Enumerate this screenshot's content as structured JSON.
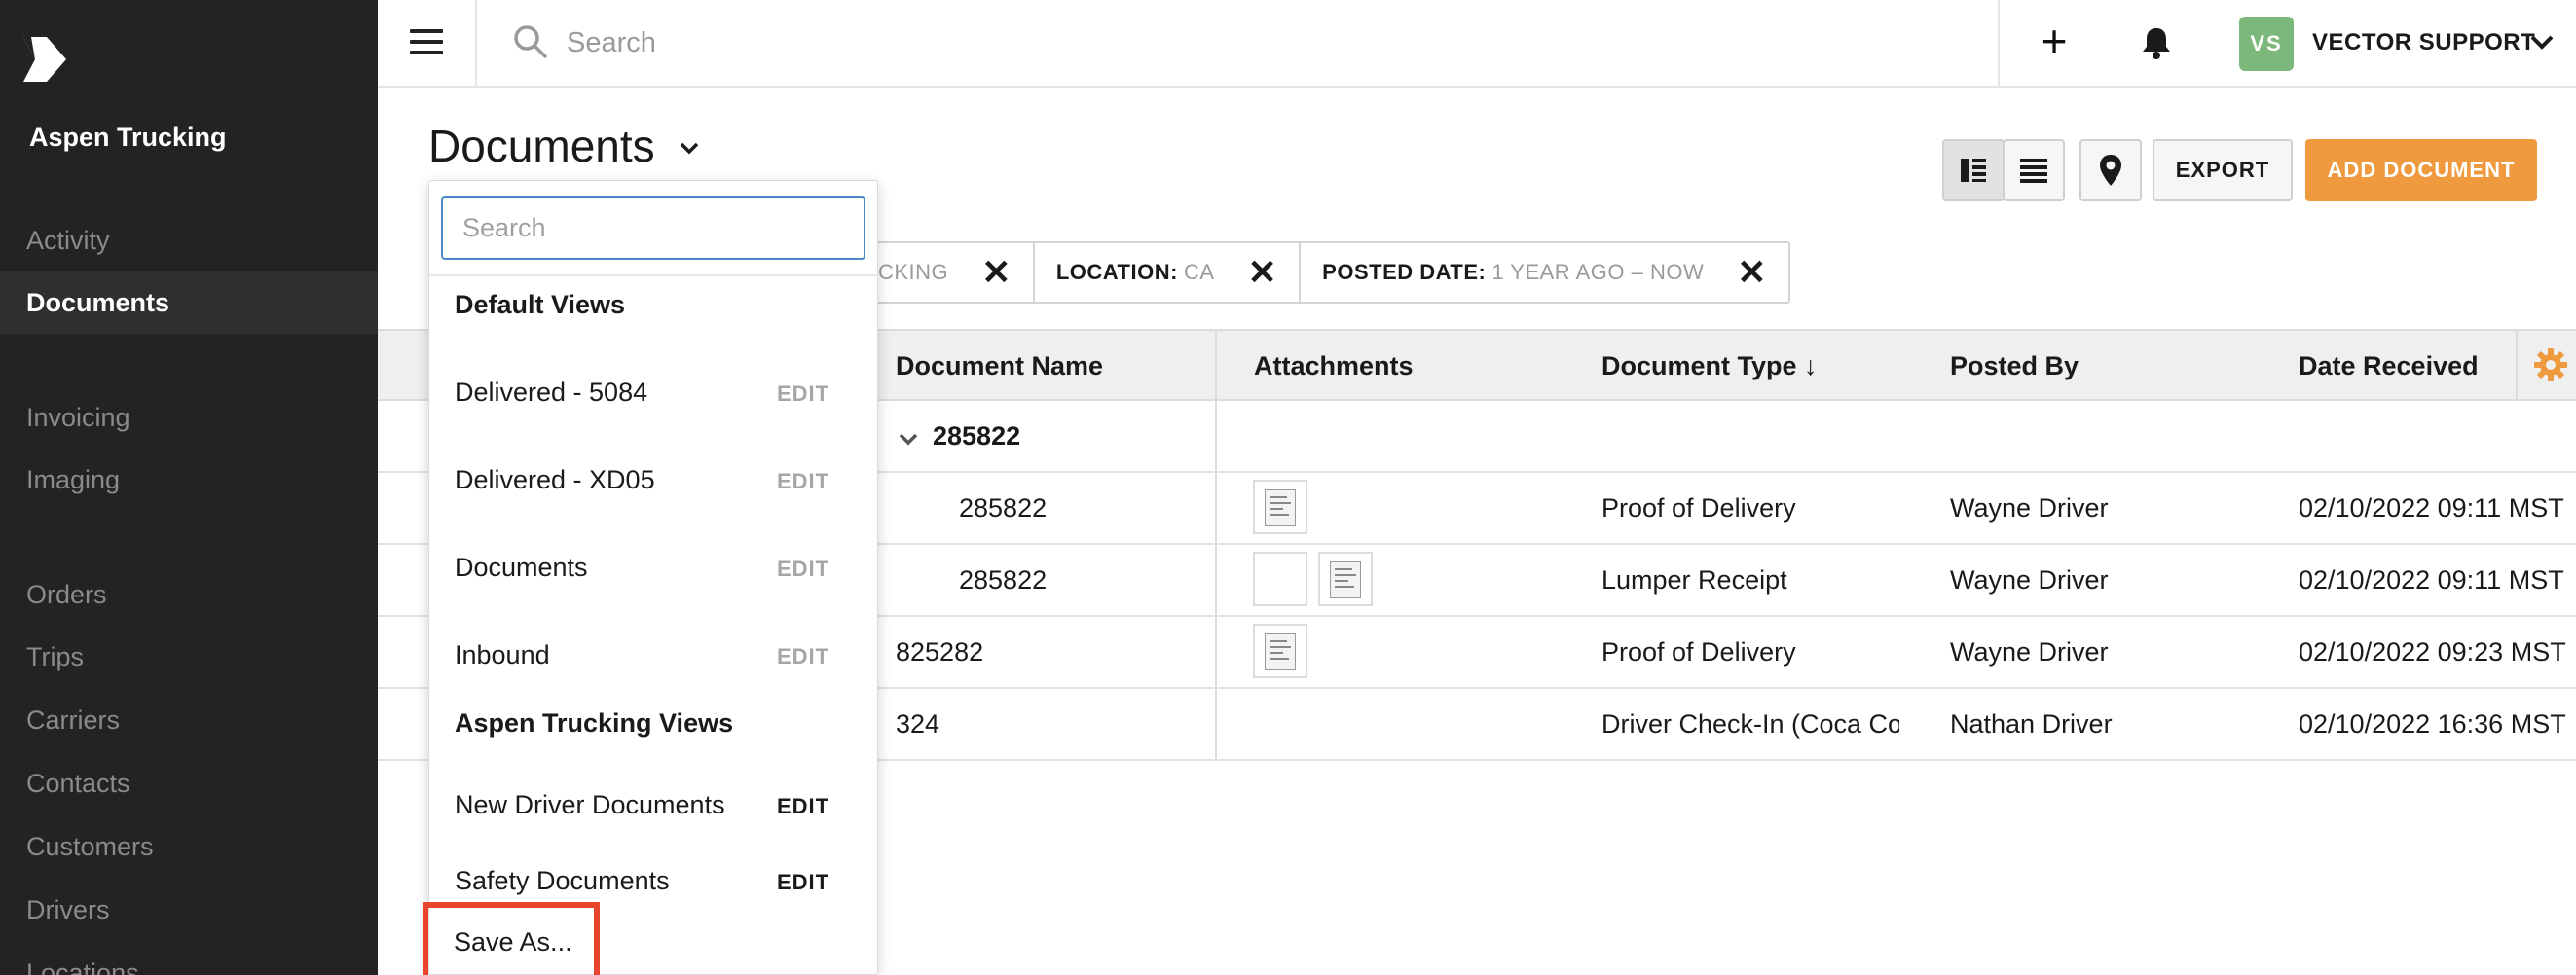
{
  "org_name": "Aspen Trucking",
  "sidebar": {
    "items": [
      {
        "label": "Activity",
        "active": false
      },
      {
        "label": "Documents",
        "active": true
      },
      {
        "label": "Invoicing",
        "active": false
      },
      {
        "label": "Imaging",
        "active": false
      },
      {
        "label": "Orders",
        "active": false
      },
      {
        "label": "Trips",
        "active": false
      },
      {
        "label": "Carriers",
        "active": false
      },
      {
        "label": "Contacts",
        "active": false
      },
      {
        "label": "Customers",
        "active": false
      },
      {
        "label": "Drivers",
        "active": false
      },
      {
        "label": "Locations",
        "active": false
      }
    ]
  },
  "topbar": {
    "search_placeholder": "Search",
    "add_icon": "plus-icon",
    "notifications_icon": "bell-icon",
    "user_initials": "VS",
    "user_name": "VECTOR SUPPORT",
    "avatar_color": "#7cb87c"
  },
  "page": {
    "title": "Documents",
    "export_label": "EXPORT",
    "add_label": "ADD DOCUMENT",
    "accent_color": "#ef9a3e"
  },
  "filters": [
    {
      "key": "",
      "value": "CKING"
    },
    {
      "key": "LOCATION:",
      "value": "CA"
    },
    {
      "key": "POSTED DATE:",
      "value": "1 YEAR AGO – NOW"
    }
  ],
  "table": {
    "columns": [
      "Document Name",
      "Attachments",
      "Document Type ↓",
      "Posted By",
      "Date Received"
    ],
    "group_label": "285822",
    "rows": [
      {
        "name": "285822",
        "type": "Proof of Delivery",
        "posted_by": "Wayne Driver",
        "date": "02/10/2022 09:11 MST"
      },
      {
        "name": "285822",
        "type": "Lumper Receipt",
        "posted_by": "Wayne Driver",
        "date": "02/10/2022 09:11 MST"
      },
      {
        "name": "825282",
        "type": "Proof of Delivery",
        "posted_by": "Wayne Driver",
        "date": "02/10/2022 09:23 MST"
      },
      {
        "name": "324",
        "type": "Driver Check-In (Coca Cola",
        "posted_by": "Nathan Driver",
        "date": "02/10/2022 16:36 MST"
      }
    ]
  },
  "views_dropdown": {
    "search_placeholder": "Search",
    "default_heading": "Default Views",
    "default_views": [
      {
        "label": "Delivered - 5084",
        "edit": "EDIT"
      },
      {
        "label": "Delivered - XD05",
        "edit": "EDIT"
      },
      {
        "label": "Documents",
        "edit": "EDIT"
      },
      {
        "label": "Inbound",
        "edit": "EDIT"
      }
    ],
    "org_heading": "Aspen Trucking Views",
    "org_views": [
      {
        "label": "New Driver Documents",
        "edit": "EDIT"
      },
      {
        "label": "Safety Documents",
        "edit": "EDIT"
      }
    ],
    "save_as": "Save As...",
    "highlight_color": "#e8432c"
  }
}
